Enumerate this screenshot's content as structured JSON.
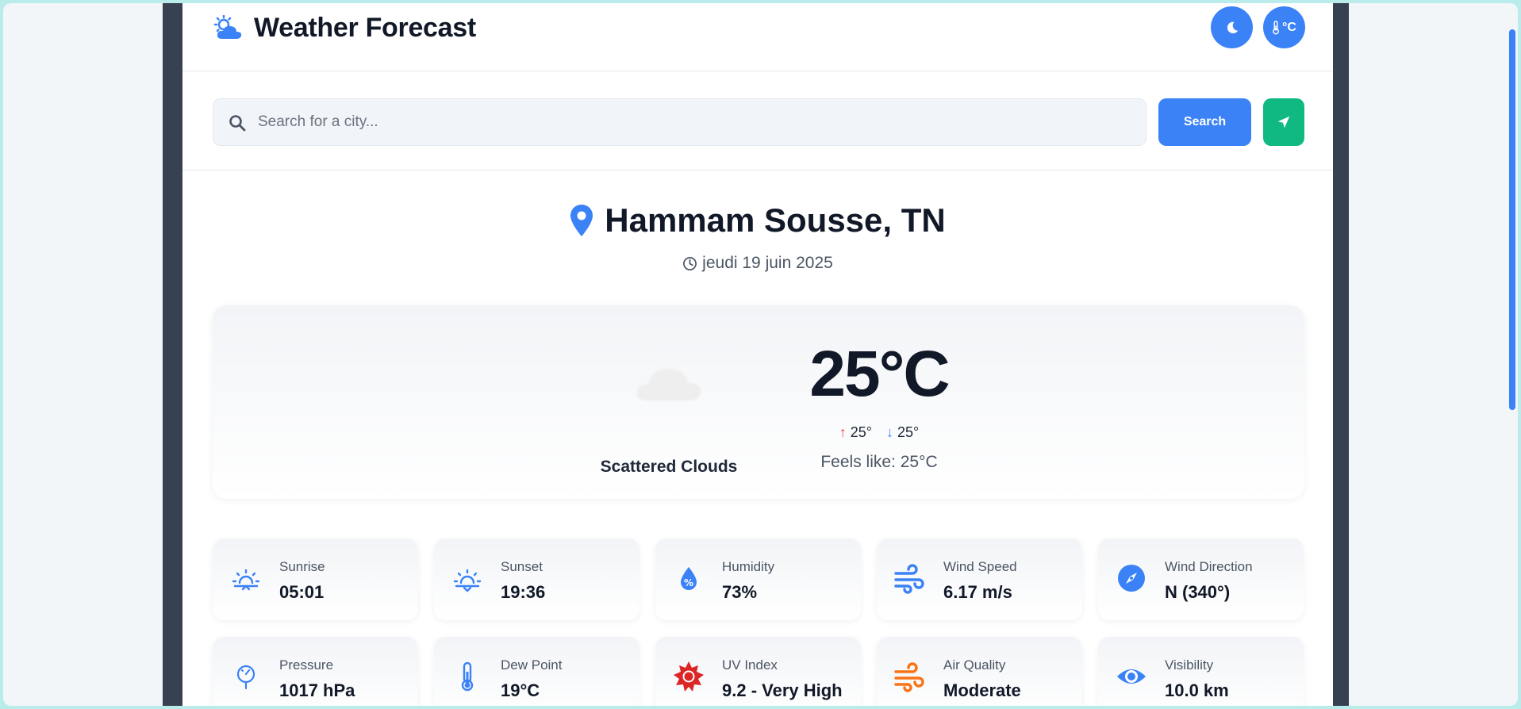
{
  "header": {
    "title": "Weather Forecast",
    "logo_icon": "cloud-sun-icon",
    "theme_icon": "moon-icon",
    "unit_label": "°C",
    "unit_icon": "thermometer-icon"
  },
  "search": {
    "placeholder": "Search for a city...",
    "button_label": "Search",
    "locate_icon": "location-arrow-icon"
  },
  "location": {
    "city": "Hammam Sousse, TN",
    "date": "jeudi 19 juin 2025"
  },
  "current": {
    "condition": "Scattered Clouds",
    "temperature": "25°C",
    "high": "25°",
    "low": "25°",
    "feels_like": "Feels like: 25°C"
  },
  "details": [
    {
      "label": "Sunrise",
      "value": "05:01",
      "icon": "sunrise-icon"
    },
    {
      "label": "Sunset",
      "value": "19:36",
      "icon": "sunset-icon"
    },
    {
      "label": "Humidity",
      "value": "73%",
      "icon": "humidity-drop-icon"
    },
    {
      "label": "Wind Speed",
      "value": "6.17 m/s",
      "icon": "wind-icon"
    },
    {
      "label": "Wind Direction",
      "value": "N (340°)",
      "icon": "compass-icon"
    },
    {
      "label": "Pressure",
      "value": "1017 hPa",
      "icon": "gauge-icon"
    },
    {
      "label": "Dew Point",
      "value": "19°C",
      "icon": "thermometer-icon"
    },
    {
      "label": "UV Index",
      "value": "9.2 - Very High",
      "icon": "sun-uv-icon"
    },
    {
      "label": "Air Quality",
      "value": "Moderate",
      "icon": "wind-air-icon"
    },
    {
      "label": "Visibility",
      "value": "10.0 km",
      "icon": "eye-icon"
    }
  ],
  "colors": {
    "accent": "#3b82f6",
    "locate_button": "#10b981",
    "frame": "#374151",
    "uv_icon": "#dc2626",
    "air_icon": "#f97316"
  }
}
